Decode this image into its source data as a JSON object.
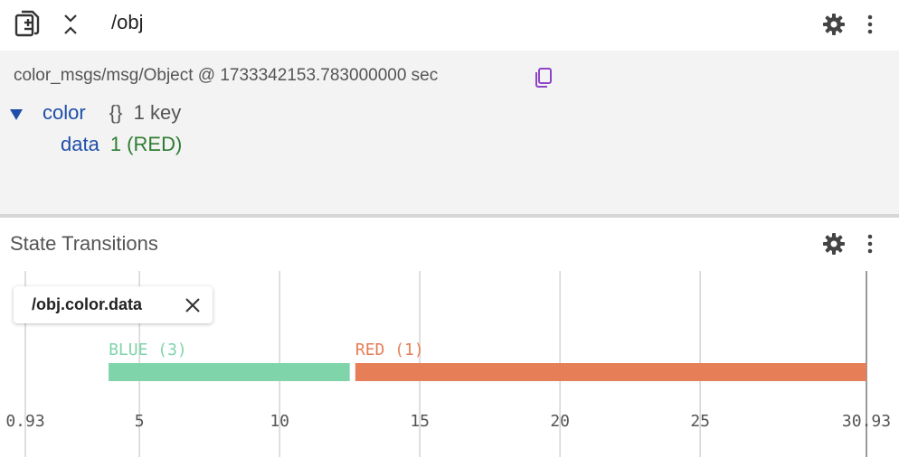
{
  "top_panel": {
    "topic": "/obj",
    "message_type": "color_msgs/msg/Object @ 1733342153.783000000 sec",
    "tree": {
      "root_key": "color",
      "root_meta": "{}  1 key",
      "child_key": "data",
      "child_value": "1 (RED)"
    }
  },
  "bottom_panel": {
    "title": "State Transitions",
    "series_label": "/obj.color.data"
  },
  "icons": {
    "add_topic": "file-plus-icon",
    "collapse": "collapse-arrows-icon",
    "settings": "gear-icon",
    "more": "more-vert-icon",
    "copy": "copy-icon",
    "close": "close-icon",
    "expand": "triangle-down-icon"
  },
  "colors": {
    "blue_state": "#7fd4aa",
    "red_state": "#e67e57",
    "key": "#1f4fa8",
    "value": "#2e7d32",
    "copy_icon": "#8e44c9"
  },
  "chart_data": {
    "type": "bar",
    "xlim": [
      0.93,
      30.93
    ],
    "x_ticks": [
      {
        "value": 0.93,
        "label": "0.93"
      },
      {
        "value": 5,
        "label": "5"
      },
      {
        "value": 10,
        "label": "10"
      },
      {
        "value": 15,
        "label": "15"
      },
      {
        "value": 20,
        "label": "20"
      },
      {
        "value": 25,
        "label": "25"
      },
      {
        "value": 30.93,
        "label": "30.93"
      }
    ],
    "grid": true,
    "series": [
      {
        "segments": [
          {
            "label": "BLUE (3)",
            "start": 3.9,
            "end": 12.5,
            "color": "#7fd4aa",
            "text_color": "#7fd4aa"
          },
          {
            "label": "RED (1)",
            "start": 12.7,
            "end": 30.93,
            "color": "#e67e57",
            "text_color": "#e67e57"
          }
        ]
      }
    ]
  }
}
